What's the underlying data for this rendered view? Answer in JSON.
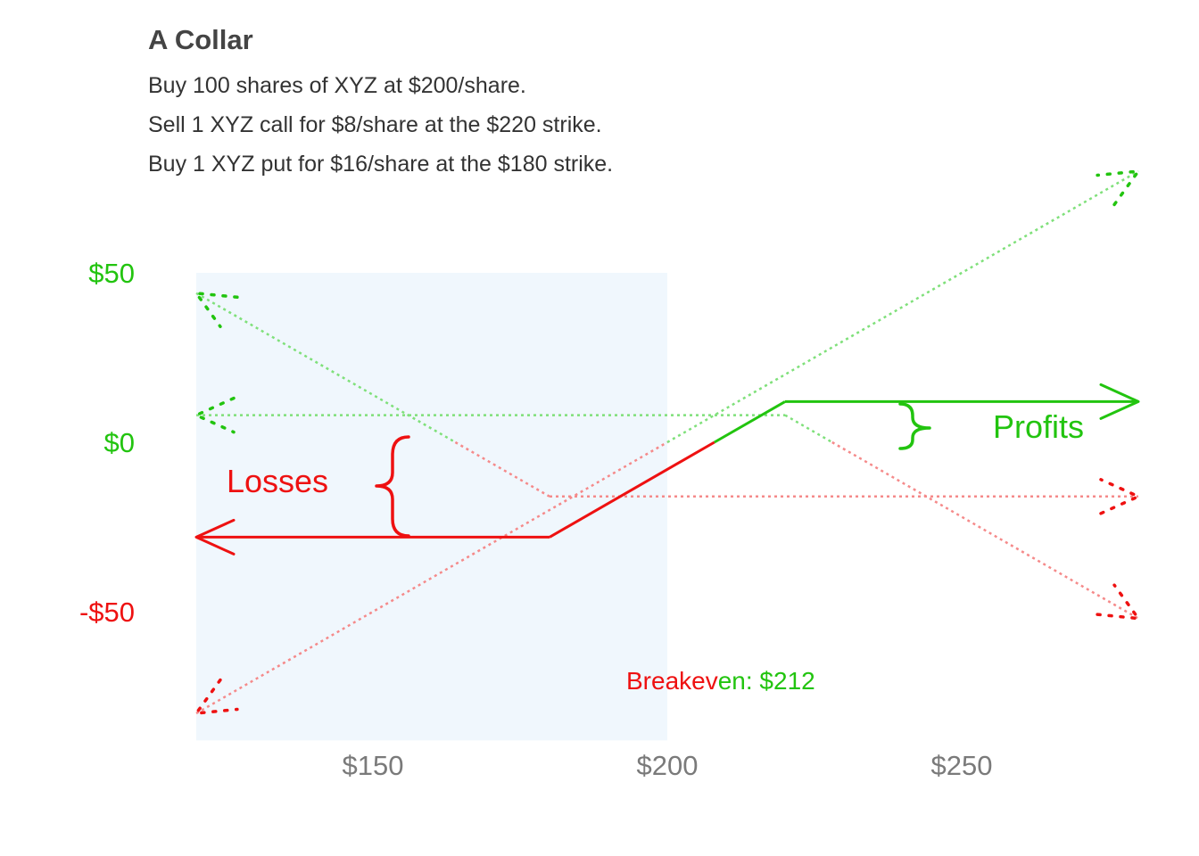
{
  "header": {
    "title": "A Collar",
    "lines": [
      "Buy 100 shares of XYZ at $200/share.",
      "Sell 1 XYZ call for $8/share at the $220 strike.",
      "Buy 1 XYZ put for $16/share at the $180 strike."
    ]
  },
  "colors": {
    "profit": "#22c40f",
    "loss": "#ee1111",
    "profit_light": "#7fe07a",
    "loss_light": "#f58a8a",
    "shade": "#f0f7fd",
    "axis_text": "#7a7a7a"
  },
  "chart_data": {
    "type": "line",
    "xlim": [
      120,
      280
    ],
    "ylim": [
      -88,
      50
    ],
    "x_ticks": [
      {
        "value": 150,
        "label": "$150"
      },
      {
        "value": 200,
        "label": "$200"
      },
      {
        "value": 250,
        "label": "$250"
      }
    ],
    "y_ticks": [
      {
        "value": 50,
        "label": "$50",
        "sign": "profit"
      },
      {
        "value": 0,
        "label": "$0",
        "sign": "profit"
      },
      {
        "value": -50,
        "label": "-$50",
        "sign": "loss"
      }
    ],
    "shaded_region": {
      "x": [
        120,
        200
      ],
      "y": [
        -88,
        50
      ]
    },
    "series": [
      {
        "role": "stock",
        "points": [
          [
            120,
            -80
          ],
          [
            280,
            80
          ]
        ]
      },
      {
        "role": "short_call",
        "points": [
          [
            120,
            8
          ],
          [
            220,
            8
          ],
          [
            280,
            -52
          ]
        ]
      },
      {
        "role": "long_put",
        "points": [
          [
            120,
            44
          ],
          [
            180,
            -16
          ],
          [
            280,
            -16
          ]
        ]
      },
      {
        "role": "combined",
        "points": [
          [
            120,
            -28
          ],
          [
            180,
            -28
          ],
          [
            220,
            12
          ],
          [
            280,
            12
          ]
        ]
      }
    ],
    "annotations": {
      "profits_label": "Profits",
      "losses_label": "Losses",
      "breakeven": {
        "value": 212,
        "text_loss": "Breakev",
        "text_profit": "en: $212"
      }
    }
  }
}
